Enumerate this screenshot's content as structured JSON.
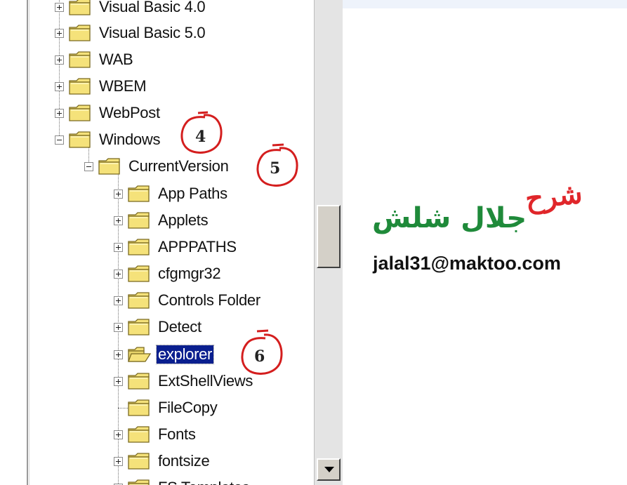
{
  "tree": {
    "items": [
      {
        "label": "Visual Basic 4.0",
        "expander": "plus"
      },
      {
        "label": "Visual Basic 5.0",
        "expander": "plus"
      },
      {
        "label": "WAB",
        "expander": "plus"
      },
      {
        "label": "WBEM",
        "expander": "plus"
      },
      {
        "label": "WebPost",
        "expander": "plus"
      },
      {
        "label": "Windows",
        "expander": "minus"
      },
      {
        "label": "CurrentVersion",
        "expander": "minus"
      },
      {
        "label": "App Paths",
        "expander": "plus"
      },
      {
        "label": "Applets",
        "expander": "plus"
      },
      {
        "label": "APPPATHS",
        "expander": "plus"
      },
      {
        "label": "cfgmgr32",
        "expander": "plus"
      },
      {
        "label": "Controls Folder",
        "expander": "plus"
      },
      {
        "label": "Detect",
        "expander": "plus"
      },
      {
        "label": "explorer",
        "expander": "plus",
        "selected": true,
        "open_folder": true
      },
      {
        "label": "ExtShellViews",
        "expander": "plus"
      },
      {
        "label": "FileCopy",
        "expander": "none"
      },
      {
        "label": "Fonts",
        "expander": "plus"
      },
      {
        "label": "fontsize",
        "expander": "plus"
      },
      {
        "label": "FS Templates",
        "expander": "plus"
      }
    ]
  },
  "callouts": [
    {
      "number": "4",
      "color": "#d41e1e"
    },
    {
      "number": "5",
      "color": "#d41e1e"
    },
    {
      "number": "6",
      "color": "#d41e1e"
    }
  ],
  "signature": {
    "title_red": "شرح",
    "name_green": "جلال شلش",
    "email": "jalal31@maktoo.com"
  },
  "colors": {
    "selection": "#0a1f8f",
    "folder": "#f5e27a",
    "name_green": "#1f8a3a",
    "title_red": "#e0262a"
  }
}
